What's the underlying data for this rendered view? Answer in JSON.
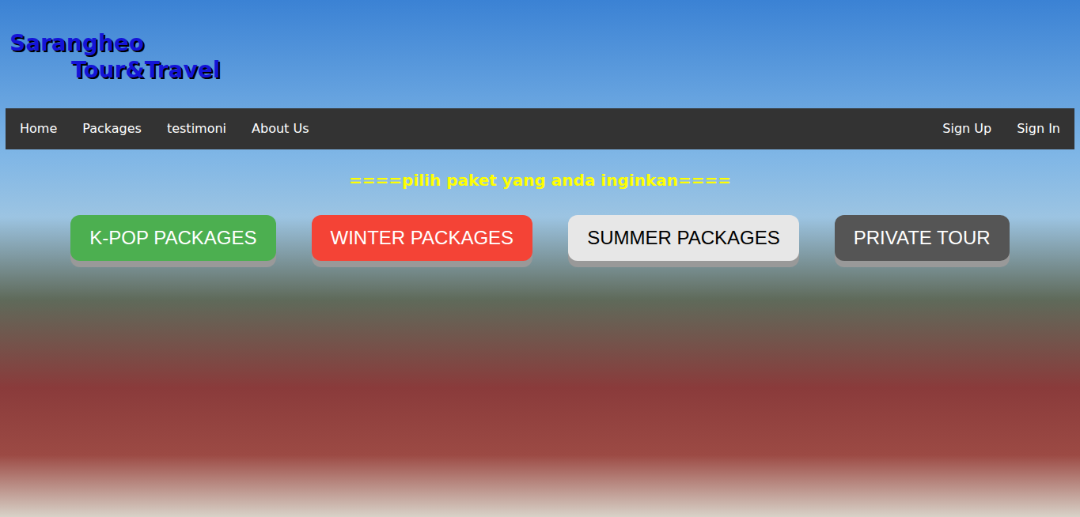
{
  "logo": {
    "line1": "Sarangheo",
    "line2": "Tour&Travel"
  },
  "nav": {
    "left": [
      "Home",
      "Packages",
      "testimoni",
      "About Us"
    ],
    "right": [
      "Sign Up",
      "Sign In"
    ]
  },
  "heading": "====pilih paket yang anda inginkan====",
  "packages": [
    {
      "label": "K-POP PACKAGES",
      "color": "#4caf50"
    },
    {
      "label": "WINTER PACKAGES",
      "color": "#f44336"
    },
    {
      "label": "SUMMER PACKAGES",
      "color": "#e7e7e7"
    },
    {
      "label": "PRIVATE TOUR",
      "color": "#555555"
    }
  ]
}
